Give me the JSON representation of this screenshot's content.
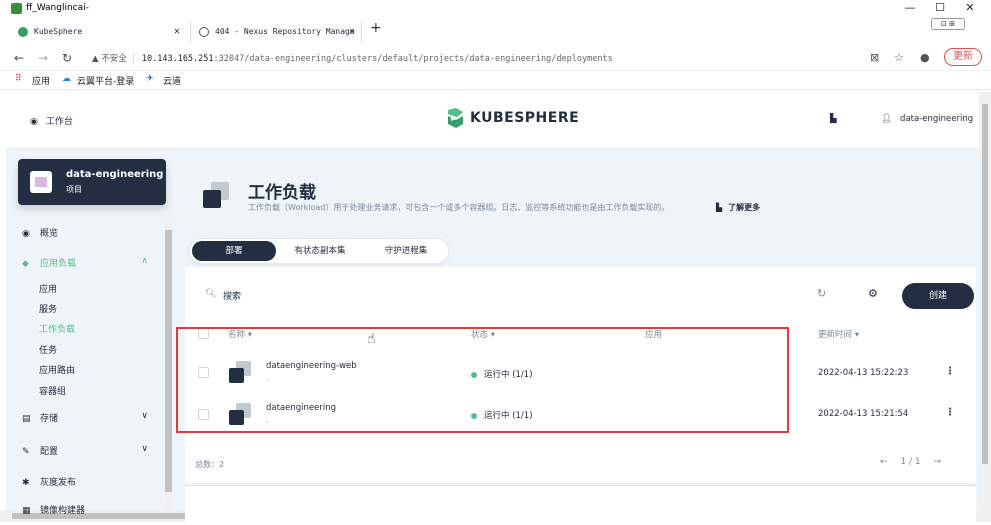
{
  "window": {
    "title": "ff_Wanglincai-",
    "min": "—",
    "max": "☐",
    "close": "✕"
  },
  "browser": {
    "tabs": [
      {
        "label": "KubeSphere",
        "close": "✕"
      },
      {
        "label": "404 - Nexus Repository Manage",
        "close": "✕"
      }
    ],
    "new_tab": "+",
    "url_warning": "▲ 不安全",
    "url_host": "10.143.165.251",
    "url_path": ":32047/data-engineering/clusters/default/projects/data-engineering/deployments",
    "update_label": "更新",
    "bookmarks": [
      "应用",
      "云翼平台-登录",
      "云道"
    ]
  },
  "header": {
    "workbench": "工作台",
    "logo": "KUBESPHERE",
    "user": "data-engineering"
  },
  "project": {
    "name": "data-engineering",
    "type": "项目"
  },
  "sidebar": {
    "items": [
      {
        "label": "概览",
        "icon": "◉"
      },
      {
        "label": "应用负载",
        "icon": "◆",
        "chevron": "∧"
      },
      {
        "label": "存储",
        "icon": "▤",
        "chevron": "∨"
      },
      {
        "label": "配置",
        "icon": "✎",
        "chevron": "∨"
      },
      {
        "label": "灰度发布",
        "icon": "✱"
      },
      {
        "label": "镜像构建器",
        "icon": "▦"
      }
    ],
    "subitems": [
      "应用",
      "服务",
      "工作负载",
      "任务",
      "应用路由",
      "容器组"
    ]
  },
  "main": {
    "title": "工作负载",
    "description": "工作负载（Workload）用于处理业务请求，可包含一个或多个容器组。日志、监控等系统功能也是由工作负载实现的。",
    "learn_more": "了解更多",
    "tabs": [
      "部署",
      "有状态副本集",
      "守护进程集"
    ],
    "search_placeholder": "搜索",
    "create_label": "创建",
    "columns": {
      "name": "名称 ▾",
      "status": "状态 ▾",
      "app": "应用",
      "updated": "更新时间 ▾"
    },
    "rows": [
      {
        "name": "dataengineering-web",
        "sub": "-",
        "status": "运行中 (1/1)",
        "updated": "2022-04-13 15:22:23",
        "more": "⋮"
      },
      {
        "name": "dataengineering",
        "sub": "-",
        "status": "运行中 (1/1)",
        "updated": "2022-04-13 15:21:54",
        "more": "⋮"
      }
    ],
    "total": "总数：2",
    "pager": {
      "prev": "←",
      "page": "1 / 1",
      "next": "→"
    }
  },
  "colors": {
    "primary": "#242e42",
    "success": "#55bc8a",
    "highlight": "#e03a3a",
    "bg": "#eff4f9"
  }
}
